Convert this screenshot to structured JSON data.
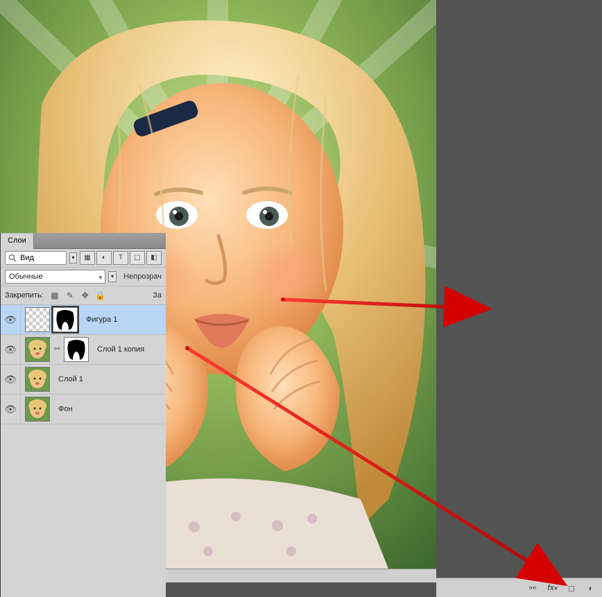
{
  "panel": {
    "tab_label": "Слои",
    "search": {
      "placeholder": "Вид"
    },
    "filter_icons": [
      "image-filter-icon",
      "adjustment-filter-icon",
      "type-filter-icon",
      "shape-filter-icon",
      "smart-filter-icon"
    ],
    "blend_mode": "Обычные",
    "opacity_label": "Непрозрач",
    "lock_label": "Закрепить:",
    "fill_label": "За"
  },
  "layers": [
    {
      "visible": true,
      "name": "Фигура 1",
      "selected": true,
      "has_mask": true,
      "has_link": false,
      "thumb_type": "checker",
      "mask_type": "silhouette"
    },
    {
      "visible": true,
      "name": "Слой 1 копия",
      "selected": false,
      "has_mask": true,
      "has_link": true,
      "thumb_type": "photo",
      "mask_type": "silhouette"
    },
    {
      "visible": true,
      "name": "Слой 1",
      "selected": false,
      "has_mask": false,
      "has_link": false,
      "thumb_type": "photo"
    },
    {
      "visible": true,
      "name": "Фон",
      "selected": false,
      "has_mask": false,
      "has_link": false,
      "thumb_type": "photo",
      "locked": true
    }
  ],
  "footer_icons": [
    "link-icon",
    "fx-icon",
    "mask-icon",
    "adjustment-icon"
  ]
}
